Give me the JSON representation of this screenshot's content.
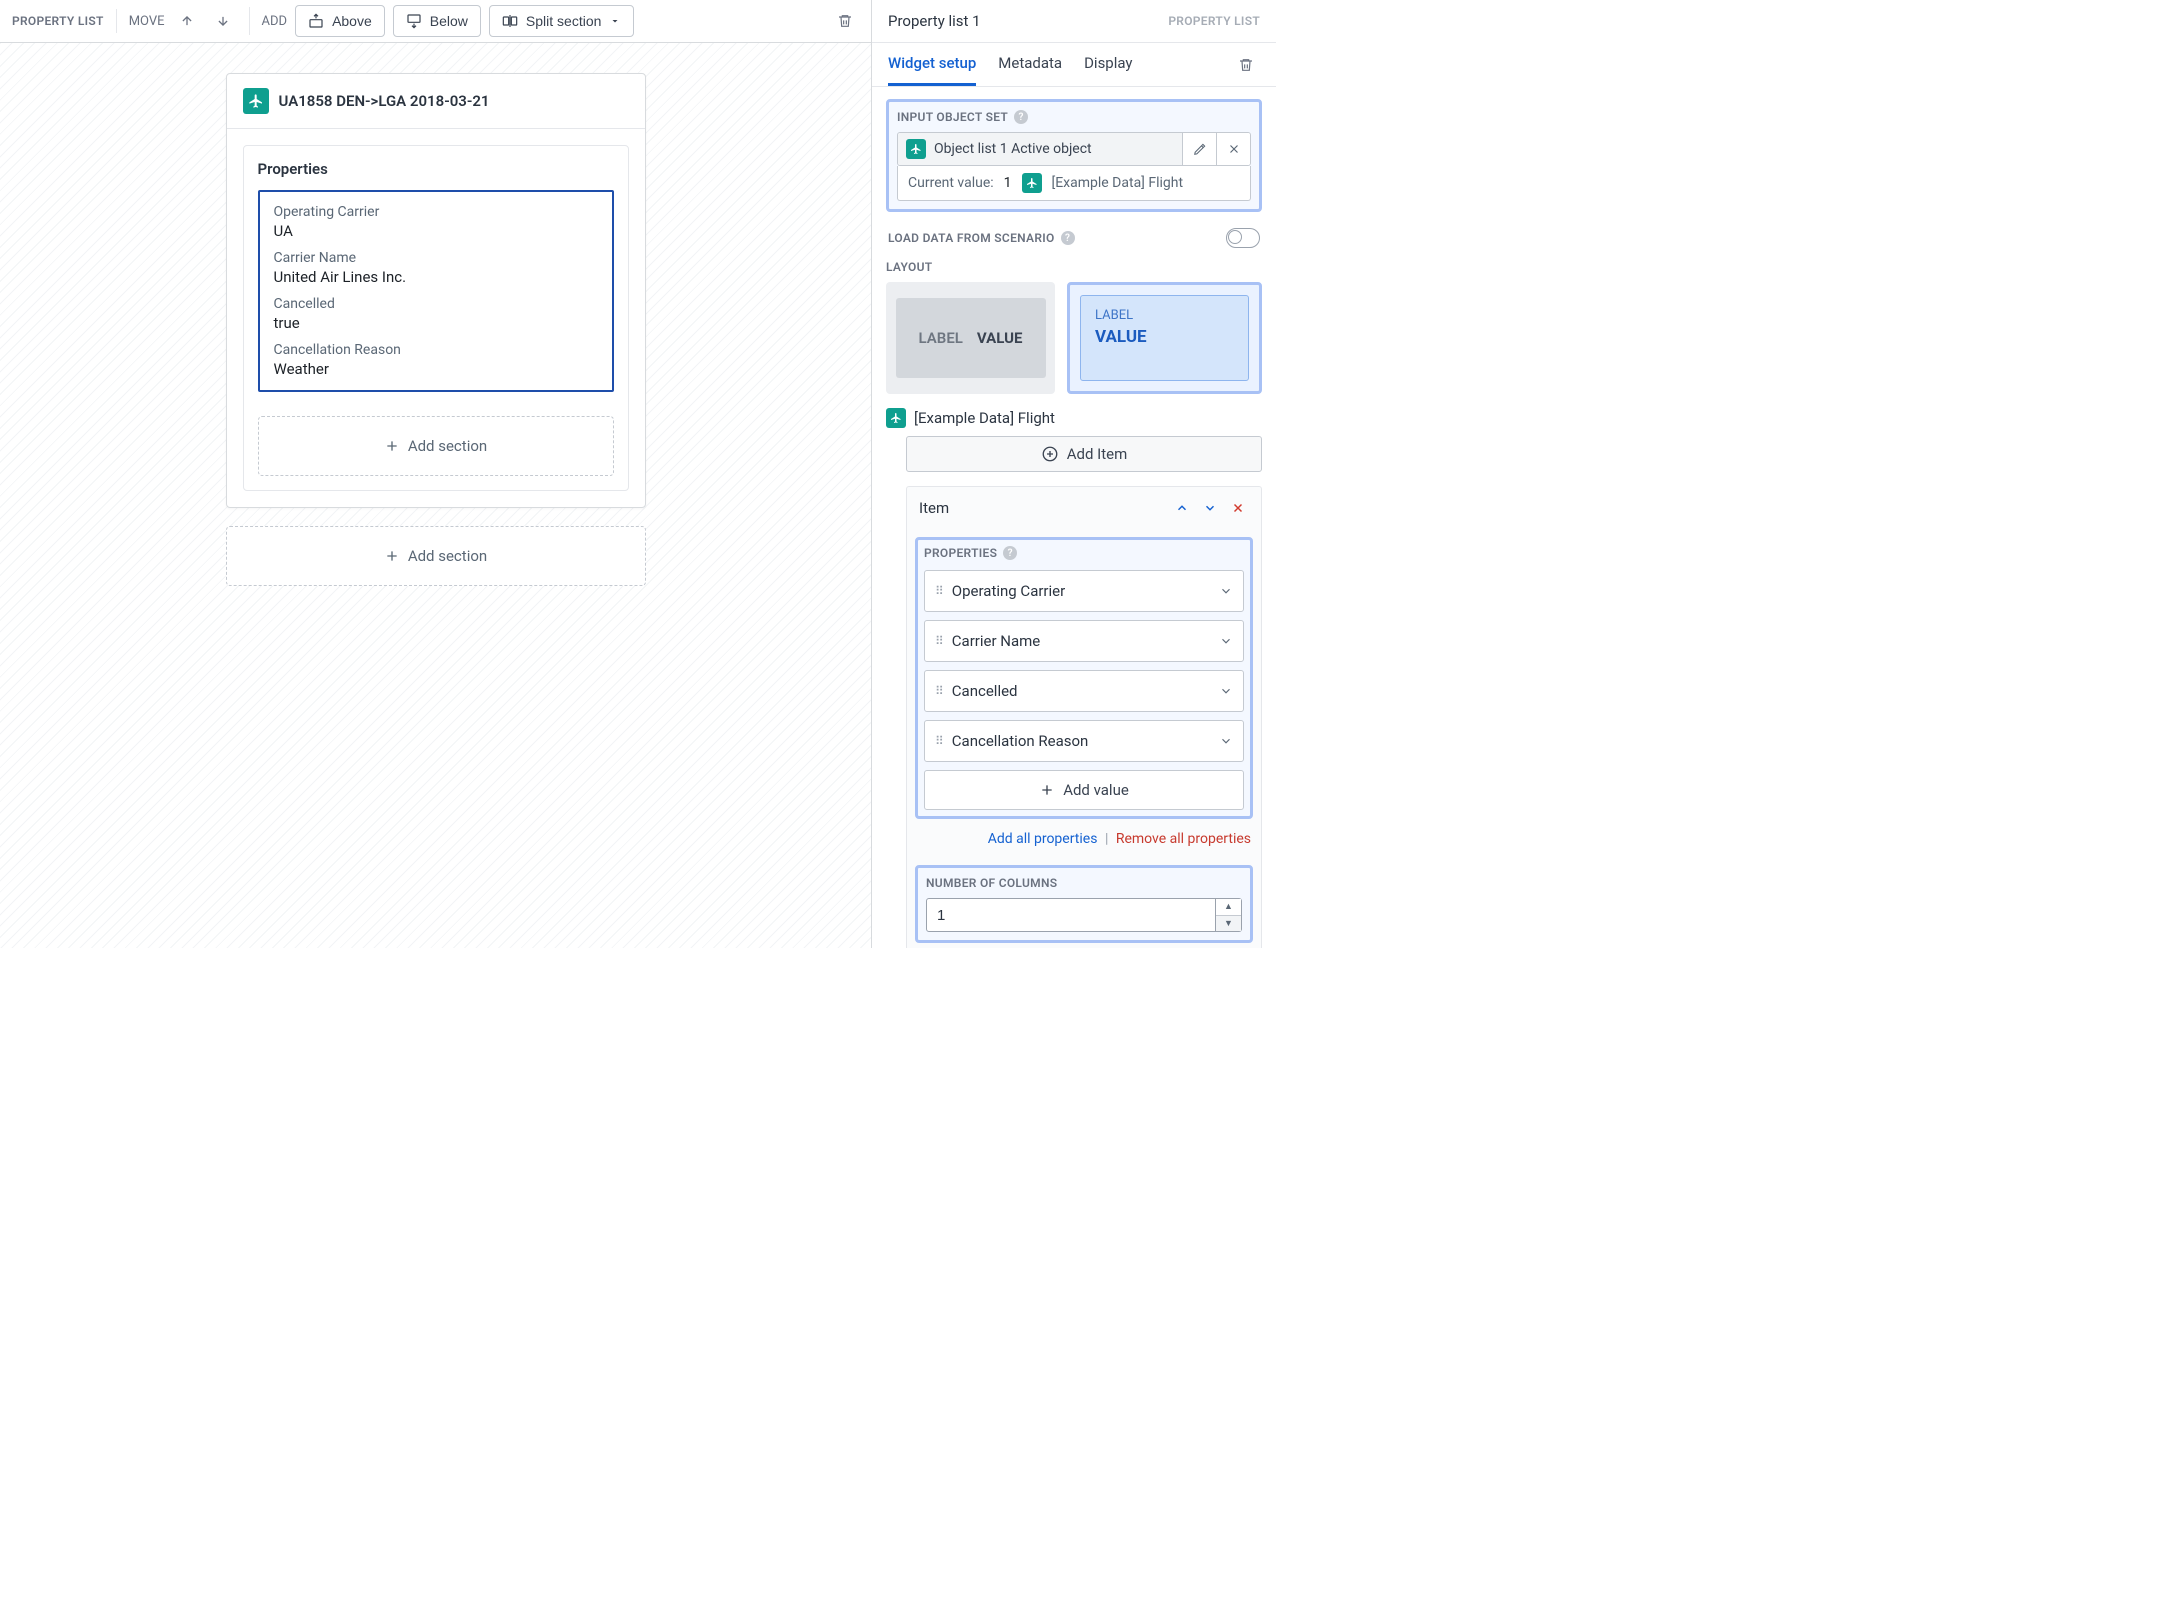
{
  "toolbar": {
    "breadcrumb": "PROPERTY LIST",
    "move_label": "MOVE",
    "add_label": "ADD",
    "above": "Above",
    "below": "Below",
    "split": "Split section"
  },
  "widget": {
    "title": "UA1858 DEN->LGA 2018-03-21",
    "panel_title": "Properties",
    "props": [
      {
        "label": "Operating Carrier",
        "value": "UA"
      },
      {
        "label": "Carrier Name",
        "value": "United Air Lines Inc."
      },
      {
        "label": "Cancelled",
        "value": "true"
      },
      {
        "label": "Cancellation Reason",
        "value": "Weather"
      }
    ],
    "add_section": "Add section"
  },
  "side": {
    "title": "Property list 1",
    "type": "PROPERTY LIST",
    "tabs": {
      "setup": "Widget setup",
      "metadata": "Metadata",
      "display": "Display"
    },
    "input_object_set": {
      "label": "INPUT OBJECT SET",
      "chip": "Object list 1 Active object",
      "current_label": "Current value:",
      "count": "1",
      "example": "[Example Data] Flight"
    },
    "load_scenario": "LOAD DATA FROM SCENARIO",
    "layout_label": "LAYOUT",
    "layout": {
      "label_txt": "LABEL",
      "value_txt": "VALUE"
    },
    "obj_type": "[Example Data] Flight",
    "add_item": "Add Item",
    "item": {
      "title": "Item",
      "properties_label": "PROPERTIES",
      "props": [
        "Operating Carrier",
        "Carrier Name",
        "Cancelled",
        "Cancellation Reason"
      ],
      "add_value": "Add value",
      "add_all": "Add all properties",
      "remove_all": "Remove all properties"
    },
    "num_columns": {
      "label": "NUMBER OF COLUMNS",
      "value": "1"
    }
  }
}
